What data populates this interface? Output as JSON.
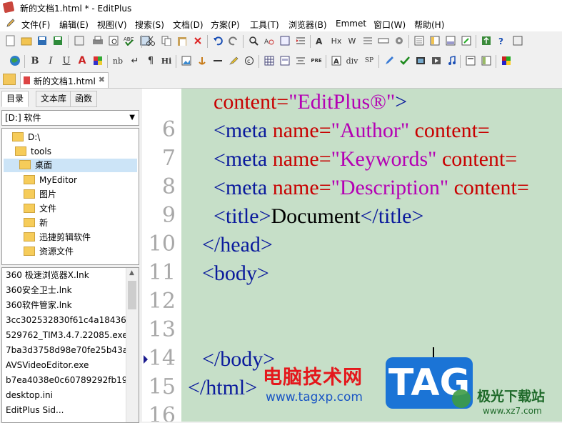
{
  "window": {
    "title": "新的文档1.html * - EditPlus"
  },
  "menu": [
    "文件(F)",
    "编辑(E)",
    "视图(V)",
    "搜索(S)",
    "文档(D)",
    "方案(P)",
    "工具(T)",
    "浏览器(B)",
    "Emmet",
    "窗口(W)",
    "帮助(H)"
  ],
  "toolbar2_labels": {
    "bold": "B",
    "italic": "I",
    "underline": "U",
    "font": "A",
    "nbsp": "nb",
    "br": "↵",
    "para": "¶",
    "heading": "Hi",
    "pre": "PRE",
    "div": "div",
    "span": "SP",
    "hx": "Hx"
  },
  "doc_tab": {
    "label": "新的文档1.html"
  },
  "sidebar": {
    "tabs": [
      "目录",
      "文本库",
      "函数"
    ],
    "drive": "[D:] 软件",
    "tree": [
      "D:\\",
      "tools",
      "桌面",
      "MyEditor",
      "图片",
      "文件",
      "新",
      "迅捷剪辑软件",
      "资源文件"
    ],
    "files": [
      "360 极速浏览器X.lnk",
      "360安全卫士.lnk",
      "360软件管家.lnk",
      "3cc302532830f61c4a1843616",
      "529762_TIM3.4.7.22085.exe",
      "7ba3d3758d98e70fe25b43a0",
      "AVSVideoEditor.exe",
      "b7ea4038e0c60789292fb194",
      "desktop.ini",
      "EditPlus Sid..."
    ]
  },
  "editor": {
    "line_numbers": [
      "6",
      "7",
      "8",
      "9",
      "10",
      "11",
      "12",
      "13",
      "14",
      "15",
      "16"
    ],
    "l0_attr": "content=",
    "l0_val": "\"EditPlus®\"",
    "l0_end": ">",
    "l6_open": "<meta ",
    "l6_attr1": "name=",
    "l6_val1": "\"Author\"",
    "l6_attr2": " content=",
    "l7_open": "<meta ",
    "l7_attr1": "name=",
    "l7_val1": "\"Keywords\"",
    "l7_attr2": " content=",
    "l8_open": "<meta ",
    "l8_attr1": "name=",
    "l8_val1": "\"Description\"",
    "l8_attr2": " content=",
    "l9_open": "<title>",
    "l9_text": "Document",
    "l9_close": "</title>",
    "l10": "</head>",
    "l11": "<body>",
    "l14": "</body>",
    "l15": "</html>"
  },
  "watermark": {
    "cn_site": "电脑技术网",
    "url": "www.tagxp.com",
    "tag": "TAG",
    "brand": "极光下载站",
    "brand_url": "www.xz7.com"
  }
}
